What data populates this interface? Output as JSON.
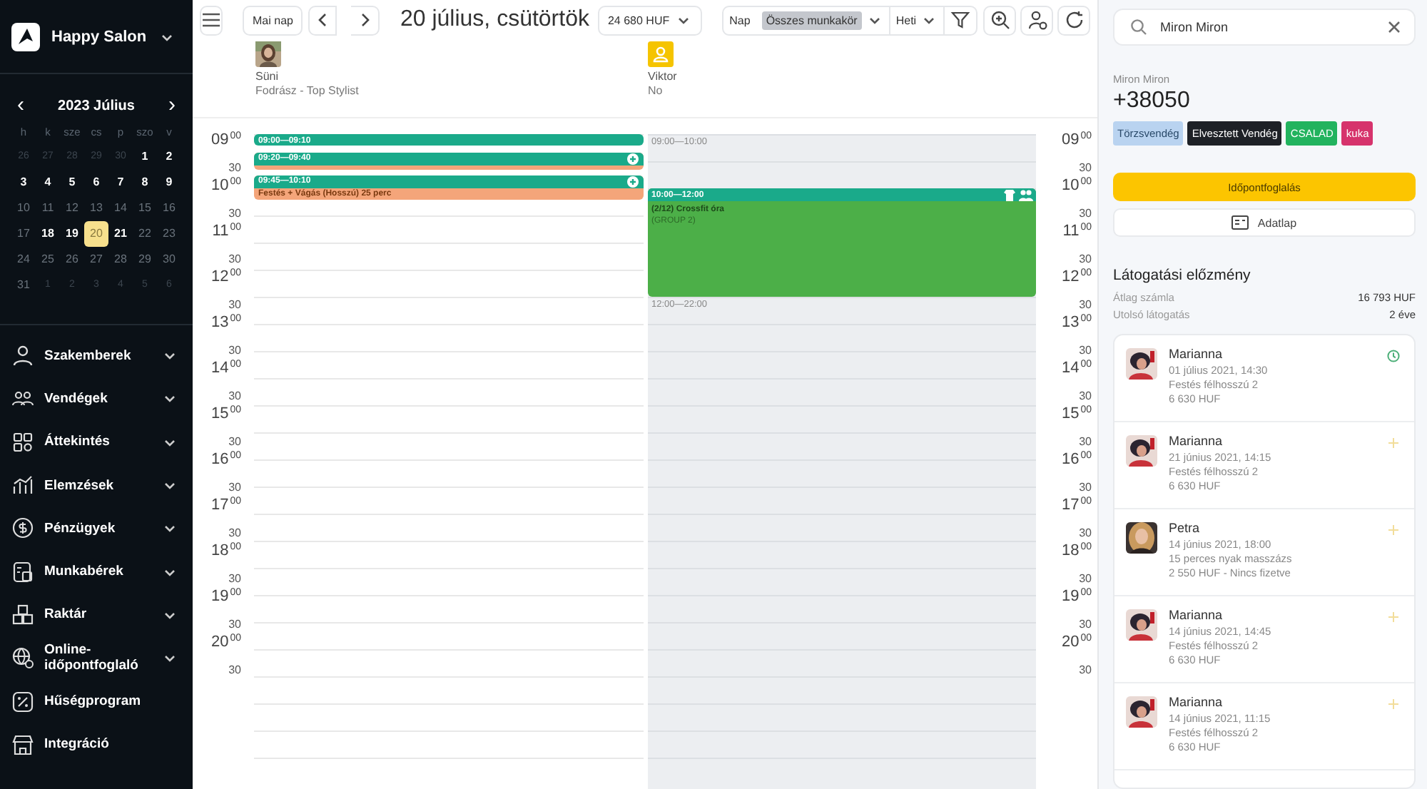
{
  "sidebar": {
    "brand": "Happy Salon",
    "mini_calendar": {
      "title": "2023 Július",
      "prev": "‹",
      "next": "›",
      "weekdays": [
        "h",
        "k",
        "sze",
        "cs",
        "p",
        "szo",
        "v"
      ],
      "days": [
        {
          "day": "26",
          "kind": "other",
          "selected": false
        },
        {
          "day": "27",
          "kind": "other",
          "selected": false
        },
        {
          "day": "28",
          "kind": "other",
          "selected": false
        },
        {
          "day": "29",
          "kind": "other",
          "selected": false
        },
        {
          "day": "30",
          "kind": "other",
          "selected": false
        },
        {
          "day": "1",
          "kind": "bold",
          "selected": false
        },
        {
          "day": "2",
          "kind": "bold",
          "selected": false
        },
        {
          "day": "3",
          "kind": "bold",
          "selected": false
        },
        {
          "day": "4",
          "kind": "bold",
          "selected": false
        },
        {
          "day": "5",
          "kind": "bold",
          "selected": false
        },
        {
          "day": "6",
          "kind": "bold",
          "selected": false
        },
        {
          "day": "7",
          "kind": "bold",
          "selected": false
        },
        {
          "day": "8",
          "kind": "bold",
          "selected": false
        },
        {
          "day": "9",
          "kind": "bold",
          "selected": false
        },
        {
          "day": "10",
          "kind": "dim",
          "selected": false
        },
        {
          "day": "11",
          "kind": "dim",
          "selected": false
        },
        {
          "day": "12",
          "kind": "dim",
          "selected": false
        },
        {
          "day": "13",
          "kind": "dim",
          "selected": false
        },
        {
          "day": "14",
          "kind": "dim",
          "selected": false
        },
        {
          "day": "15",
          "kind": "dim",
          "selected": false
        },
        {
          "day": "16",
          "kind": "dim",
          "selected": false
        },
        {
          "day": "17",
          "kind": "dim",
          "selected": false
        },
        {
          "day": "18",
          "kind": "bold",
          "selected": false
        },
        {
          "day": "19",
          "kind": "bold",
          "selected": false
        },
        {
          "day": "20",
          "kind": "dim",
          "selected": true
        },
        {
          "day": "21",
          "kind": "bold",
          "selected": false
        },
        {
          "day": "22",
          "kind": "dim",
          "selected": false
        },
        {
          "day": "23",
          "kind": "dim",
          "selected": false
        },
        {
          "day": "24",
          "kind": "dim",
          "selected": false
        },
        {
          "day": "25",
          "kind": "dim",
          "selected": false
        },
        {
          "day": "26",
          "kind": "dim",
          "selected": false
        },
        {
          "day": "27",
          "kind": "dim",
          "selected": false
        },
        {
          "day": "28",
          "kind": "dim",
          "selected": false
        },
        {
          "day": "29",
          "kind": "dim",
          "selected": false
        },
        {
          "day": "30",
          "kind": "dim",
          "selected": false
        },
        {
          "day": "31",
          "kind": "dim",
          "selected": false
        },
        {
          "day": "1",
          "kind": "other",
          "selected": false
        },
        {
          "day": "2",
          "kind": "other",
          "selected": false
        },
        {
          "day": "3",
          "kind": "other",
          "selected": false
        },
        {
          "day": "4",
          "kind": "other",
          "selected": false
        },
        {
          "day": "5",
          "kind": "other",
          "selected": false
        },
        {
          "day": "6",
          "kind": "other",
          "selected": false
        }
      ]
    },
    "items": [
      {
        "label": "Szakemberek",
        "expandable": true
      },
      {
        "label": "Vendégek",
        "expandable": true
      },
      {
        "label": "Áttekintés",
        "expandable": true
      },
      {
        "label": "Elemzések",
        "expandable": true
      },
      {
        "label": "Pénzügyek",
        "expandable": true
      },
      {
        "label": "Munkabérek",
        "expandable": true
      },
      {
        "label": "Raktár",
        "expandable": true
      },
      {
        "label": "Online-időpontfoglaló",
        "expandable": true
      },
      {
        "label": "Hűségprogram",
        "expandable": false
      },
      {
        "label": "Integráció",
        "expandable": false
      }
    ]
  },
  "toolbar": {
    "today": "Mai nap",
    "date_title": "20 július, csütörtök",
    "revenue": "24 680 HUF",
    "view_label": "Nap",
    "role_filter": "Összes munkakör",
    "period": "Heti"
  },
  "staff": [
    {
      "name": "Süni",
      "role": "Fodrász - Top Stylist"
    },
    {
      "name": "Viktor",
      "role": "No"
    }
  ],
  "left_times": [
    {
      "hour": "09",
      "minute": "00",
      "half": "30"
    },
    {
      "hour": "10",
      "minute": "00",
      "half": "30"
    },
    {
      "hour": "11",
      "minute": "00",
      "half": "30"
    },
    {
      "hour": "12",
      "minute": "00",
      "half": "30"
    },
    {
      "hour": "13",
      "minute": "00",
      "half": "30"
    },
    {
      "hour": "14",
      "minute": "00",
      "half": "30"
    },
    {
      "hour": "15",
      "minute": "00",
      "half": "30"
    },
    {
      "hour": "16",
      "minute": "00",
      "half": "30"
    },
    {
      "hour": "17",
      "minute": "00",
      "half": "30"
    },
    {
      "hour": "18",
      "minute": "00",
      "half": "30"
    },
    {
      "hour": "19",
      "minute": "00",
      "half": "30"
    },
    {
      "hour": "20",
      "minute": "00",
      "half": "30"
    }
  ],
  "right_times": [
    {
      "hour": "09",
      "minute": "00",
      "half": "30"
    },
    {
      "hour": "10",
      "minute": "00",
      "half": "30"
    },
    {
      "hour": "11",
      "minute": "00",
      "half": "30"
    },
    {
      "hour": "12",
      "minute": "00",
      "half": "30"
    },
    {
      "hour": "13",
      "minute": "00",
      "half": "30"
    },
    {
      "hour": "14",
      "minute": "00",
      "half": "30"
    },
    {
      "hour": "15",
      "minute": "00",
      "half": "30"
    },
    {
      "hour": "16",
      "minute": "00",
      "half": "30"
    },
    {
      "hour": "17",
      "minute": "00",
      "half": "30"
    },
    {
      "hour": "18",
      "minute": "00",
      "half": "30"
    },
    {
      "hour": "19",
      "minute": "00",
      "half": "30"
    },
    {
      "hour": "20",
      "minute": "00",
      "half": "30"
    }
  ],
  "columns": [
    {
      "events": [
        {
          "time": "09:00—09:10",
          "kind": "short"
        },
        {
          "time": "09:20—09:40",
          "kind": "service",
          "color": "#f4a57a"
        },
        {
          "time": "09:45—10:10",
          "kind": "service",
          "color": "#f4a57a",
          "title": "Festés + Vágás (Hosszú) 25 perc"
        }
      ]
    },
    {
      "off_hours": [
        "09:00—10:00",
        "12:00—22:00"
      ],
      "events": [
        {
          "time": "10:00—12:00",
          "kind": "group",
          "color": "#4caf48",
          "title": "(2/12) Crossfit óra",
          "subtitle": "(GROUP 2)"
        }
      ]
    }
  ],
  "client_panel": {
    "search": "Miron Miron",
    "name": "Miron Miron",
    "phone": "+38050",
    "tags": [
      {
        "label": "Törzsvendég",
        "color": "#b9d3f0"
      },
      {
        "label": "Elvesztett Vendég",
        "color": "#1e2126"
      },
      {
        "label": "CSALAD",
        "color": "#22b35e"
      },
      {
        "label": "kuka",
        "color": "#d6336c"
      }
    ],
    "book_button": "Időpontfoglalás",
    "profile_button": "Adatlap",
    "history_title": "Látogatási előzmény",
    "stats": [
      {
        "label": "Átlag számla",
        "value": "16 793 HUF"
      },
      {
        "label": "Utolsó látogatás",
        "value": "2 éve"
      }
    ],
    "visits": [
      {
        "name": "Marianna",
        "date": "01 július 2021, 14:30",
        "service": "Festés félhosszú 2",
        "price": "6 630 HUF",
        "kind": "upcoming"
      },
      {
        "name": "Marianna",
        "date": "21 június 2021, 14:15",
        "service": "Festés félhosszú 2",
        "price": "6 630 HUF",
        "kind": "past"
      },
      {
        "name": "Petra",
        "date": "14 június 2021, 18:00",
        "service": "15 perces nyak masszázs",
        "price": "2 550 HUF - Nincs fizetve",
        "kind": "past"
      },
      {
        "name": "Marianna",
        "date": "14 június 2021, 14:45",
        "service": "Festés félhosszú 2",
        "price": "6 630 HUF",
        "kind": "past"
      },
      {
        "name": "Marianna",
        "date": "14 június 2021, 11:15",
        "service": "Festés félhosszú 2",
        "price": "6 630 HUF",
        "kind": "past"
      }
    ]
  }
}
